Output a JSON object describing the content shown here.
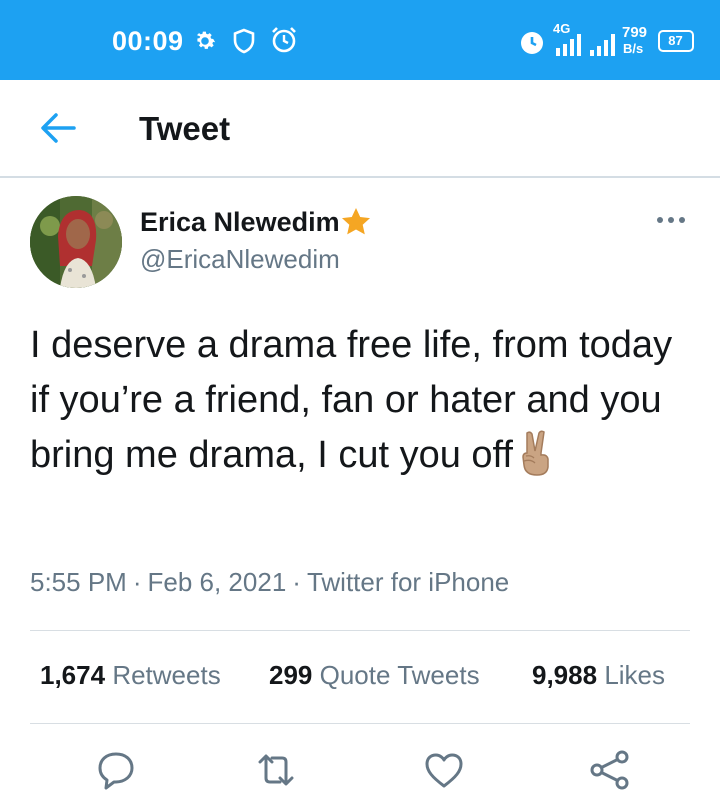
{
  "status_bar": {
    "time": "00:09",
    "network": "4G",
    "speed_value": "799",
    "speed_unit": "B/s",
    "battery": "87",
    "icons": [
      "gear-icon",
      "shield-icon",
      "alarm-icon",
      "alarm-icon",
      "signal-icon",
      "signal-icon",
      "battery-icon"
    ]
  },
  "header": {
    "title": "Tweet",
    "back_icon": "arrow-left-icon"
  },
  "tweet": {
    "author_name": "Erica Nlewedim",
    "author_handle": "@EricaNlewedim",
    "badge_icon": "star-icon",
    "text": "I deserve a drama free life, from today if you’re a friend, fan or hater and you bring me drama, I cut you off",
    "emoji_icon": "victory-hand-icon",
    "time": "5:55 PM",
    "date": "Feb 6, 2021",
    "source": "Twitter for iPhone",
    "separator": "·"
  },
  "stats": {
    "retweets_count": "1,674",
    "retweets_label": "Retweets",
    "quotes_count": "299",
    "quotes_label": "Quote Tweets",
    "likes_count": "9,988",
    "likes_label": "Likes"
  },
  "actions": [
    "reply-icon",
    "retweet-icon",
    "like-icon",
    "share-icon"
  ],
  "colors": {
    "accent": "#1da1f2",
    "text_primary": "#14171a",
    "text_secondary": "#657786",
    "badge": "#f5a623"
  }
}
